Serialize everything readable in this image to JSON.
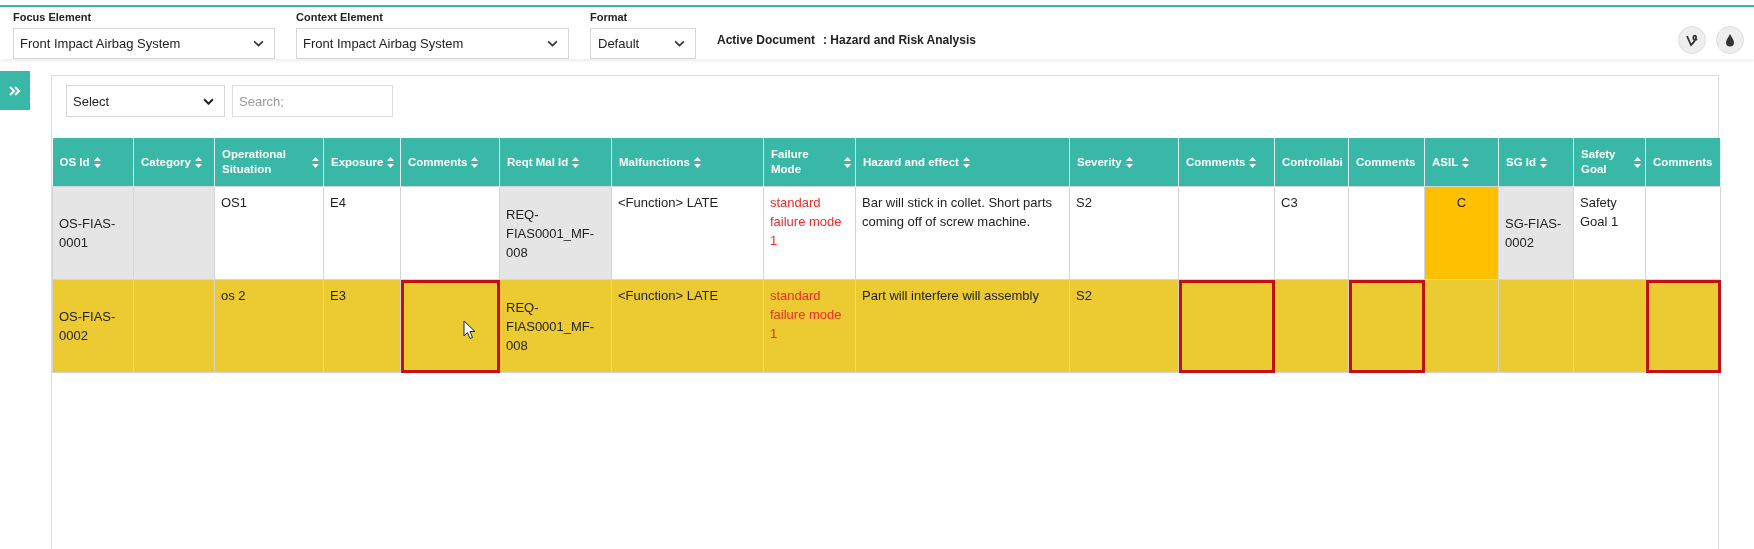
{
  "toolbar": {
    "focus_element": {
      "label": "Focus Element",
      "value": "Front Impact Airbag System"
    },
    "context_element": {
      "label": "Context Element",
      "value": "Front Impact Airbag System"
    },
    "format": {
      "label": "Format",
      "value": "Default"
    },
    "active_document": {
      "label": "Active Document",
      "value": ": Hazard and Risk Analysis"
    }
  },
  "filter": {
    "select": "Select",
    "search_placeholder": "Search;"
  },
  "table": {
    "columns": [
      {
        "label": "OS Id",
        "kind": "id",
        "sortable": true
      },
      {
        "label": "Category",
        "kind": "id",
        "sortable": true
      },
      {
        "label": "Operational Situation",
        "kind": "text",
        "sortable": true
      },
      {
        "label": "Exposure",
        "kind": "text",
        "sortable": true
      },
      {
        "label": "Comments",
        "kind": "text",
        "sortable": true
      },
      {
        "label": "Reqt Mal Id",
        "kind": "id",
        "sortable": true
      },
      {
        "label": "Malfunctions",
        "kind": "text",
        "sortable": true
      },
      {
        "label": "Failure Mode",
        "kind": "failure",
        "sortable": true
      },
      {
        "label": "Hazard and effect",
        "kind": "text",
        "sortable": true
      },
      {
        "label": "Severity",
        "kind": "text",
        "sortable": true
      },
      {
        "label": "Comments",
        "kind": "text",
        "sortable": true
      },
      {
        "label": "Controllabi",
        "kind": "text",
        "sortable": false
      },
      {
        "label": "Comments",
        "kind": "text",
        "sortable": false
      },
      {
        "label": "ASIL",
        "kind": "asil",
        "sortable": true
      },
      {
        "label": "SG Id",
        "kind": "id",
        "sortable": true
      },
      {
        "label": "Safety Goal",
        "kind": "text",
        "sortable": true
      },
      {
        "label": "Comments",
        "kind": "text",
        "sortable": false
      }
    ],
    "rows": [
      {
        "selected": false,
        "cells": [
          {
            "text": "OS-FIAS-0001",
            "outlined": false
          },
          {
            "outlined": false
          },
          {
            "text": "OS1",
            "outlined": false
          },
          {
            "text": "E4",
            "outlined": false
          },
          {
            "outlined": false
          },
          {
            "text": "REQ-FIAS0001_MF-008",
            "outlined": false
          },
          {
            "text": "<Function> LATE",
            "outlined": false
          },
          {
            "text": "standard failure mode 1",
            "outlined": false
          },
          {
            "text": "Bar will stick in collet. Short parts coming off of screw machine.",
            "outlined": false
          },
          {
            "text": "S2",
            "outlined": false
          },
          {
            "outlined": false
          },
          {
            "text": "C3",
            "outlined": false
          },
          {
            "outlined": false
          },
          {
            "text": "C",
            "outlined": false
          },
          {
            "text": "SG-FIAS-0002",
            "outlined": false
          },
          {
            "text": "Safety Goal 1",
            "outlined": false
          },
          {
            "outlined": false
          }
        ]
      },
      {
        "selected": true,
        "cells": [
          {
            "text": "OS-FIAS-0002",
            "outlined": false
          },
          {
            "outlined": false
          },
          {
            "text": "os 2",
            "outlined": false
          },
          {
            "text": "E3",
            "outlined": false
          },
          {
            "outlined": true
          },
          {
            "text": "REQ-FIAS0001_MF-008",
            "outlined": false
          },
          {
            "text": "<Function> LATE",
            "outlined": false
          },
          {
            "text": "standard failure mode 1",
            "outlined": false
          },
          {
            "text": "Part will interfere will assembly",
            "outlined": false
          },
          {
            "text": "S2",
            "outlined": false
          },
          {
            "outlined": true
          },
          {
            "outlined": false
          },
          {
            "outlined": true
          },
          {
            "outlined": false
          },
          {
            "outlined": false
          },
          {
            "outlined": false
          },
          {
            "outlined": true
          }
        ]
      }
    ]
  }
}
